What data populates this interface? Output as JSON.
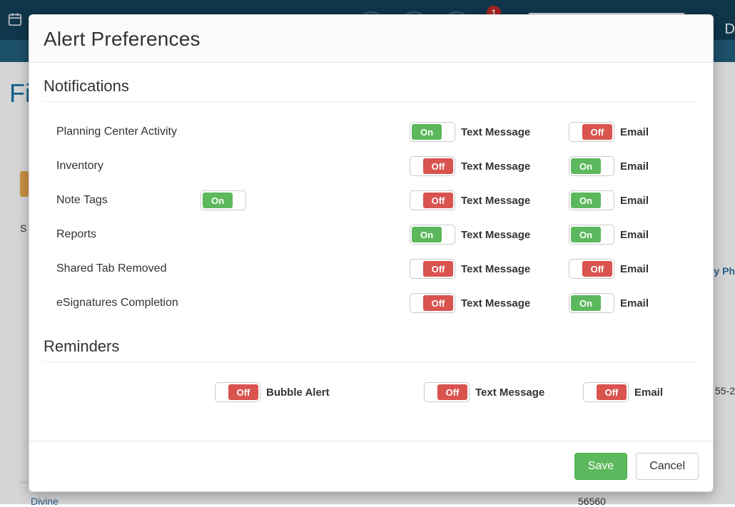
{
  "toggle": {
    "on_label": "On",
    "off_label": "Off"
  },
  "modal": {
    "title": "Alert Preferences",
    "sections": {
      "notifications": {
        "title": "Notifications",
        "channel_labels": {
          "text": "Text Message",
          "email": "Email"
        },
        "rows": [
          {
            "label": "Planning Center Activity",
            "extra_toggle": null,
            "text_on": true,
            "email_on": false
          },
          {
            "label": "Inventory",
            "extra_toggle": null,
            "text_on": false,
            "email_on": true
          },
          {
            "label": "Note Tags",
            "extra_toggle": true,
            "text_on": false,
            "email_on": true
          },
          {
            "label": "Reports",
            "extra_toggle": null,
            "text_on": true,
            "email_on": true
          },
          {
            "label": "Shared Tab Removed",
            "extra_toggle": null,
            "text_on": false,
            "email_on": false
          },
          {
            "label": "eSignatures Completion",
            "extra_toggle": null,
            "text_on": false,
            "email_on": true
          }
        ]
      },
      "reminders": {
        "title": "Reminders",
        "channel_labels": {
          "bubble": "Bubble Alert",
          "text": "Text Message",
          "email": "Email"
        },
        "bubble_on": false,
        "text_on": false,
        "email_on": false
      }
    },
    "buttons": {
      "save": "Save",
      "cancel": "Cancel"
    }
  },
  "background": {
    "left_partial": "Fi",
    "right_partial": "D",
    "badge_count": "1",
    "s_text": "S",
    "link_text": "Divine",
    "zip_text": "56560",
    "phone_partial": "55-2",
    "col_partial": "y Ph"
  }
}
